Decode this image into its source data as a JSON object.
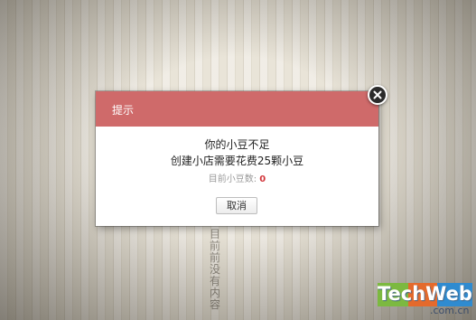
{
  "background": {
    "vertical_text": "目前前没有内容"
  },
  "dialog": {
    "title": "提示",
    "message_line1": "你的小豆不足",
    "message_line2": "创建小店需要花费25颗小豆",
    "count_label": "目前小豆数:",
    "count_value": "0",
    "cancel_label": "取消"
  },
  "watermark": {
    "brand": "TechWeb",
    "domain": ".com.cn"
  },
  "colors": {
    "header": "#cf6a6a",
    "count_value": "#d2373c"
  },
  "icons": {
    "close": "close-icon"
  }
}
